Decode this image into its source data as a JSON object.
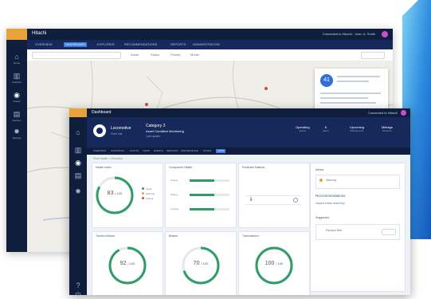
{
  "colors": {
    "navy": "#0f1e3d",
    "navy_light": "#16295a",
    "accent_blue": "#3e7be0",
    "logo_orange": "#e8a23a",
    "gauge_green": "#2e9e66",
    "avatar_purple": "#c94fd1"
  },
  "back_window": {
    "title": "Hitachi",
    "user_text": "Connected to Hitachi  ·  User: A. Smith",
    "tabs": [
      "OVERVIEW",
      "DASHBOARD",
      "EXPLORER",
      "RECOMMENDATIONS",
      "REPORTS",
      "ADMINISTRATION"
    ],
    "active_tab_index": 1,
    "sidebar": [
      {
        "icon": "home-icon",
        "label": "Home"
      },
      {
        "icon": "chart-icon",
        "label": "Analytics"
      },
      {
        "icon": "asset-icon",
        "label": "Assets"
      },
      {
        "icon": "grid-icon",
        "label": "Devices"
      },
      {
        "icon": "settings-icon",
        "label": "Settings"
      }
    ],
    "filter_labels": [
      "Asset",
      "Status",
      "Priority",
      "Model"
    ],
    "popup_badge": "41"
  },
  "front_window": {
    "title": "Dashboard",
    "user_text": "Connected to Hitachi",
    "asset_name": "Locomotive",
    "asset_sub": "Fleet unit",
    "header_title": "Category 3",
    "header_sub": "Asset Condition Monitoring",
    "header_meta": "Last update",
    "stats": [
      {
        "value": "Operating",
        "label": "Status"
      },
      {
        "value": "8",
        "label": "Alerts"
      },
      {
        "value": "Upcoming",
        "label": "Maintenance"
      },
      {
        "value": "Mileage",
        "label": "Distance"
      }
    ],
    "tabs": [
      "OVERVIEW",
      "CONDITION",
      "FAULTS",
      "TRIPS",
      "EVENTS",
      "SENSORS",
      "MAINTENANCE",
      "NOTES",
      "LOGS"
    ],
    "active_tab_index": 8,
    "breadcrumb": "Fleet health  >  Overview",
    "cards": [
      {
        "title": "Health Index",
        "value": "83",
        "unit": "/ 100",
        "ratio": 0.83
      },
      {
        "title": "Component Health",
        "value": "",
        "unit": "",
        "ratio": 0
      },
      {
        "title": "Predicted Failures",
        "value": "",
        "unit": "",
        "ratio": 0
      },
      {
        "title": "Traction Motors",
        "value": "92",
        "unit": "/ 100",
        "ratio": 0.92
      },
      {
        "title": "Brakes",
        "value": "70",
        "unit": "/ 100",
        "ratio": 0.7
      },
      {
        "title": "Transmission",
        "value": "100",
        "unit": "/ 100",
        "ratio": 1.0
      }
    ],
    "legend": [
      "Good",
      "Warning",
      "Critical"
    ],
    "component_bars": [
      {
        "label": "Engine",
        "value": 0.62
      },
      {
        "label": "Brakes",
        "value": 0.62
      },
      {
        "label": "Cooling",
        "value": 0.62
      }
    ],
    "side_panel": {
      "title": "Alerts",
      "alert_label": "Warning",
      "section_title": "Recommendations",
      "section_sub": "Inspect brake assembly",
      "group_title": "Suggested",
      "item_label": "Replace filter"
    }
  }
}
